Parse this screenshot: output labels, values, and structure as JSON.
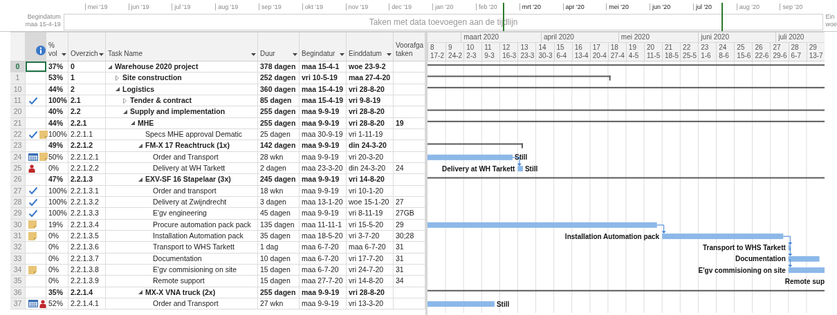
{
  "timeline": {
    "start_label": "Begindatum",
    "start_date": "maa 15-4-19",
    "end_label": "Ein",
    "end_date": "woe",
    "placeholder": "Taken met data toevoegen aan de tijdlijn",
    "months": [
      {
        "label": "mei '19",
        "in_view": false
      },
      {
        "label": "jun '19",
        "in_view": false
      },
      {
        "label": "jul '19",
        "in_view": false
      },
      {
        "label": "aug '19",
        "in_view": false
      },
      {
        "label": "sep '19",
        "in_view": false
      },
      {
        "label": "okt '19",
        "in_view": false
      },
      {
        "label": "nov '19",
        "in_view": false
      },
      {
        "label": "dec '19",
        "in_view": false
      },
      {
        "label": "jan '20",
        "in_view": false
      },
      {
        "label": "feb '20",
        "in_view": false
      },
      {
        "label": "mrt '20",
        "in_view": true
      },
      {
        "label": "apr '20",
        "in_view": true
      },
      {
        "label": "mei '20",
        "in_view": true
      },
      {
        "label": "jun '20",
        "in_view": true
      },
      {
        "label": "jul '20",
        "in_view": true
      },
      {
        "label": "aug '20",
        "in_view": false
      },
      {
        "label": "sep '20",
        "in_view": false
      }
    ]
  },
  "table": {
    "columns": [
      {
        "kind": "id"
      },
      {
        "kind": "info"
      },
      {
        "kind": "text",
        "label": "% vol",
        "filter": true
      },
      {
        "kind": "text",
        "label": "Overzich",
        "filter": true
      },
      {
        "kind": "text",
        "label": "Task Name",
        "filter": true
      },
      {
        "kind": "text",
        "label": "Duur",
        "filter": true
      },
      {
        "kind": "text",
        "label": "Begindatur",
        "filter": true
      },
      {
        "kind": "text",
        "label": "Einddatum",
        "filter": true
      },
      {
        "kind": "text",
        "label": "Voorafga taken",
        "filter": false
      }
    ],
    "rows": [
      {
        "id": "0",
        "selected": true,
        "kind": "summary",
        "expanded": true,
        "pct": "37%",
        "wbs": "0",
        "name": "Warehouse 2020 project",
        "duration": "378 dagen",
        "start": "maa 15-4-1",
        "finish": "woe 23-9-2",
        "children": [
          {
            "id": "1",
            "selected": false,
            "kind": "summary",
            "expanded": false,
            "pct": "53%",
            "wbs": "1",
            "name": "Site construction",
            "duration": "252 dagen",
            "start": "vri 10-5-19",
            "finish": "maa 27-4-20"
          },
          {
            "id": "10",
            "selected": false,
            "kind": "summary",
            "expanded": true,
            "pct": "44%",
            "wbs": "2",
            "name": "Logistics",
            "duration": "360 dagen",
            "start": "maa 15-4-19",
            "finish": "vri 28-8-20",
            "children": [
              {
                "id": "11",
                "selected": false,
                "kind": "summary",
                "expanded": false,
                "indicators": [
                  {
                    "kind": "check"
                  }
                ],
                "pct": "100%",
                "wbs": "2.1",
                "name": "Tender & contract",
                "duration": "85 dagen",
                "start": "maa 15-4-19",
                "finish": "vri 9-8-19"
              },
              {
                "id": "20",
                "selected": false,
                "kind": "summary",
                "expanded": true,
                "pct": "40%",
                "wbs": "2.2",
                "name": "Supply and implementation",
                "duration": "255 dagen",
                "start": "maa 9-9-19",
                "finish": "vri 28-8-20",
                "children": [
                  {
                    "id": "21",
                    "selected": false,
                    "kind": "summary",
                    "expanded": true,
                    "pct": "44%",
                    "wbs": "2.2.1",
                    "name": "MHE",
                    "duration": "255 dagen",
                    "start": "maa 9-9-19",
                    "finish": "vri 28-8-20",
                    "predecessors": "19",
                    "children": [
                      {
                        "id": "22",
                        "selected": false,
                        "kind": "task",
                        "indicators": [
                          {
                            "kind": "check"
                          },
                          {
                            "kind": "note"
                          }
                        ],
                        "pct": "100%",
                        "wbs": "2.2.1.1",
                        "name": "Specs MHE approval Dematic",
                        "duration": "25 dagen",
                        "start": "maa 30-9-19",
                        "finish": "vri 1-11-19"
                      },
                      {
                        "id": "23",
                        "selected": false,
                        "kind": "summary",
                        "expanded": true,
                        "pct": "49%",
                        "wbs": "2.2.1.2",
                        "name": "FM-X 17 Reachtruck (1x)",
                        "duration": "142 dagen",
                        "start": "maa 9-9-19",
                        "finish": "din 24-3-20",
                        "children": [
                          {
                            "id": "24",
                            "selected": false,
                            "kind": "task",
                            "indicators": [
                              {
                                "kind": "calendar"
                              },
                              {
                                "kind": "note"
                              }
                            ],
                            "pct": "50%",
                            "wbs": "2.2.1.2.1",
                            "name": "Order and Transport",
                            "duration": "28 wkn",
                            "start": "maa 9-9-19",
                            "finish": "vri 20-3-20",
                            "bar": {
                              "right_label": "Still"
                            }
                          },
                          {
                            "id": "25",
                            "selected": false,
                            "kind": "task",
                            "indicators": [
                              {
                                "kind": "person"
                              }
                            ],
                            "pct": "0%",
                            "wbs": "2.2.1.2.2",
                            "name": "Delivery at WH Tarkett",
                            "duration": "2 dagen",
                            "start": "maa 23-3-20",
                            "finish": "din 24-3-20",
                            "predecessors": "24",
                            "bar": {
                              "left_label": "Delivery at WH Tarkett",
                              "right_label": "Still",
                              "linked": true
                            }
                          }
                        ]
                      },
                      {
                        "id": "26",
                        "selected": false,
                        "kind": "summary",
                        "expanded": true,
                        "pct": "47%",
                        "wbs": "2.2.1.3",
                        "name": "EXV-SF 16 Stapelaar (3x)",
                        "duration": "245 dagen",
                        "start": "maa 9-9-19",
                        "finish": "vri 14-8-20",
                        "children": [
                          {
                            "id": "27",
                            "selected": false,
                            "kind": "task",
                            "indicators": [
                              {
                                "kind": "check"
                              }
                            ],
                            "pct": "100%",
                            "wbs": "2.2.1.3.1",
                            "name": "Order and transport",
                            "duration": "18 wkn",
                            "start": "maa 9-9-19",
                            "finish": "vri 10-1-20"
                          },
                          {
                            "id": "28",
                            "selected": false,
                            "kind": "task",
                            "indicators": [
                              {
                                "kind": "check"
                              }
                            ],
                            "pct": "100%",
                            "wbs": "2.2.1.3.2",
                            "name": "Delivery at Zwijndrecht",
                            "duration": "3 dagen",
                            "start": "maa 13-1-20",
                            "finish": "woe 15-1-20",
                            "predecessors": "27"
                          },
                          {
                            "id": "29",
                            "selected": false,
                            "kind": "task",
                            "indicators": [
                              {
                                "kind": "check"
                              }
                            ],
                            "pct": "100%",
                            "wbs": "2.2.1.3.3",
                            "name": "E'gv engineering",
                            "duration": "45 dagen",
                            "start": "maa 9-9-19",
                            "finish": "vri 8-11-19",
                            "predecessors": "27GB"
                          },
                          {
                            "id": "30",
                            "selected": false,
                            "kind": "task",
                            "indicators": [
                              {
                                "kind": "note"
                              }
                            ],
                            "pct": "19%",
                            "wbs": "2.2.1.3.4",
                            "name": "Procure automation pack pack",
                            "duration": "135 dagen",
                            "start": "maa 11-11-1",
                            "finish": "vri 15-5-20",
                            "predecessors": "29"
                          },
                          {
                            "id": "31",
                            "selected": false,
                            "kind": "task",
                            "indicators": [
                              {
                                "kind": "note"
                              }
                            ],
                            "pct": "0%",
                            "wbs": "2.2.1.3.5",
                            "name": "Installation Automation pack",
                            "duration": "35 dagen",
                            "start": "maa 18-5-20",
                            "finish": "vri 3-7-20",
                            "predecessors": "30;28",
                            "bar": {
                              "left_label": "Installation Automation pack",
                              "linked": true
                            }
                          },
                          {
                            "id": "32",
                            "selected": false,
                            "kind": "task",
                            "pct": "0%",
                            "wbs": "2.2.1.3.6",
                            "name": "Transport to WHS Tarkett",
                            "duration": "1 dag",
                            "start": "maa 6-7-20",
                            "finish": "maa 6-7-20",
                            "predecessors": "31",
                            "bar": {
                              "left_label": "Transport to WHS Tarkett",
                              "linked": true
                            }
                          },
                          {
                            "id": "33",
                            "selected": false,
                            "kind": "task",
                            "pct": "0%",
                            "wbs": "2.2.1.3.7",
                            "name": "Documentation",
                            "duration": "10 dagen",
                            "start": "maa 6-7-20",
                            "finish": "vri 17-7-20",
                            "predecessors": "31",
                            "bar": {
                              "left_label": "Documentation",
                              "linked": true
                            }
                          },
                          {
                            "id": "34",
                            "selected": false,
                            "kind": "task",
                            "indicators": [
                              {
                                "kind": "note"
                              }
                            ],
                            "pct": "0%",
                            "wbs": "2.2.1.3.8",
                            "name": "E'gv commisioning on site",
                            "duration": "15 dagen",
                            "start": "maa 6-7-20",
                            "finish": "vri 24-7-20",
                            "predecessors": "31",
                            "bar": {
                              "left_label": "E'gv commisioning on site",
                              "linked": true
                            }
                          },
                          {
                            "id": "35",
                            "selected": false,
                            "kind": "task",
                            "pct": "0%",
                            "wbs": "2.2.1.3.9",
                            "name": "Remote support",
                            "duration": "15 dagen",
                            "start": "maa 27-7-20",
                            "finish": "vri 14-8-20",
                            "predecessors": "34",
                            "bar": {
                              "left_label": "Remote sup"
                            }
                          }
                        ]
                      },
                      {
                        "id": "36",
                        "selected": false,
                        "kind": "summary",
                        "expanded": true,
                        "pct": "35%",
                        "wbs": "2.2.1.4",
                        "name": "MX-X VNA truck (2x)",
                        "duration": "255 dagen",
                        "start": "maa 9-9-19",
                        "finish": "vri 28-8-20",
                        "children": [
                          {
                            "id": "37",
                            "selected": false,
                            "kind": "task",
                            "indicators": [
                              {
                                "kind": "calendar"
                              },
                              {
                                "kind": "person"
                              }
                            ],
                            "pct": "52%",
                            "wbs": "2.2.1.4.1",
                            "name": "Order and Transport",
                            "duration": "27 wkn",
                            "start": "maa 9-9-19",
                            "finish": "vri 13-3-20",
                            "bar": {
                              "right_label": "Still"
                            }
                          }
                        ]
                      }
                    ]
                  }
                ]
              }
            ]
          }
        ]
      }
    ]
  },
  "gantt": {
    "months": [
      {
        "label": "maart 2020"
      },
      {
        "label": "april 2020"
      },
      {
        "label": "mei 2020"
      },
      {
        "label": "juni 2020"
      },
      {
        "label": "juli 2020"
      }
    ],
    "weeks": [
      {
        "number": "8",
        "date": "17-2"
      },
      {
        "number": "9",
        "date": "24-2"
      },
      {
        "number": "10",
        "date": "2-3"
      },
      {
        "number": "11",
        "date": "9-3"
      },
      {
        "number": "12",
        "date": "16-3"
      },
      {
        "number": "13",
        "date": "23-3"
      },
      {
        "number": "14",
        "date": "30-3"
      },
      {
        "number": "15",
        "date": "6-4"
      },
      {
        "number": "16",
        "date": "13-4"
      },
      {
        "number": "17",
        "date": "20-4"
      },
      {
        "number": "18",
        "date": "27-4"
      },
      {
        "number": "19",
        "date": "4-5"
      },
      {
        "number": "20",
        "date": "11-5"
      },
      {
        "number": "21",
        "date": "18-5"
      },
      {
        "number": "22",
        "date": "25-5"
      },
      {
        "number": "23",
        "date": "1-6"
      },
      {
        "number": "24",
        "date": "8-6"
      },
      {
        "number": "25",
        "date": "15-6"
      },
      {
        "number": "26",
        "date": "22-6"
      },
      {
        "number": "27",
        "date": "29-6"
      },
      {
        "number": "28",
        "date": "6-7"
      },
      {
        "number": "29",
        "date": "13-7"
      }
    ]
  }
}
